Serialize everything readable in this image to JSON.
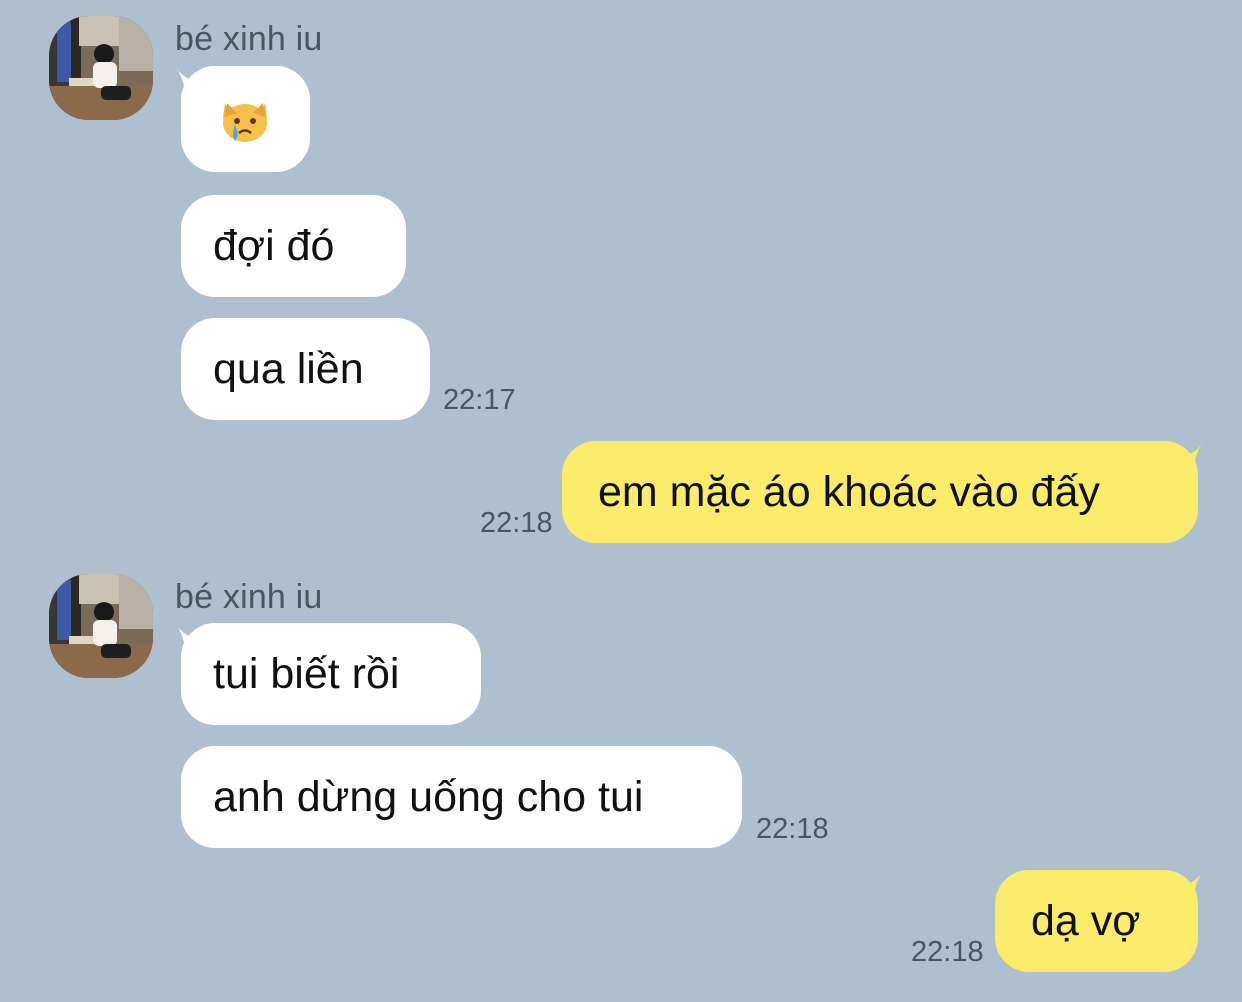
{
  "colors": {
    "background": "#aec0d0",
    "incoming_bubble": "#ffffff",
    "outgoing_bubble": "#fbeb6a",
    "meta_text": "#4a5560"
  },
  "groups": [
    {
      "sender": "bé xinh iu",
      "avatar_icon": "profile-photo",
      "messages": [
        {
          "emoji": "crying-cat-face-icon",
          "text": ""
        },
        {
          "text": "đợi đó"
        },
        {
          "text": "qua liền"
        }
      ],
      "time": "22:17"
    },
    {
      "outgoing": true,
      "messages": [
        {
          "text": "em mặc áo khoác vào đấy"
        }
      ],
      "time": "22:18"
    },
    {
      "sender": "bé xinh iu",
      "avatar_icon": "profile-photo",
      "messages": [
        {
          "text": "tui biết rồi"
        },
        {
          "text": "anh dừng uống cho tui"
        }
      ],
      "time": "22:18"
    },
    {
      "outgoing": true,
      "messages": [
        {
          "text": "dạ vợ"
        }
      ],
      "time": "22:18"
    }
  ]
}
